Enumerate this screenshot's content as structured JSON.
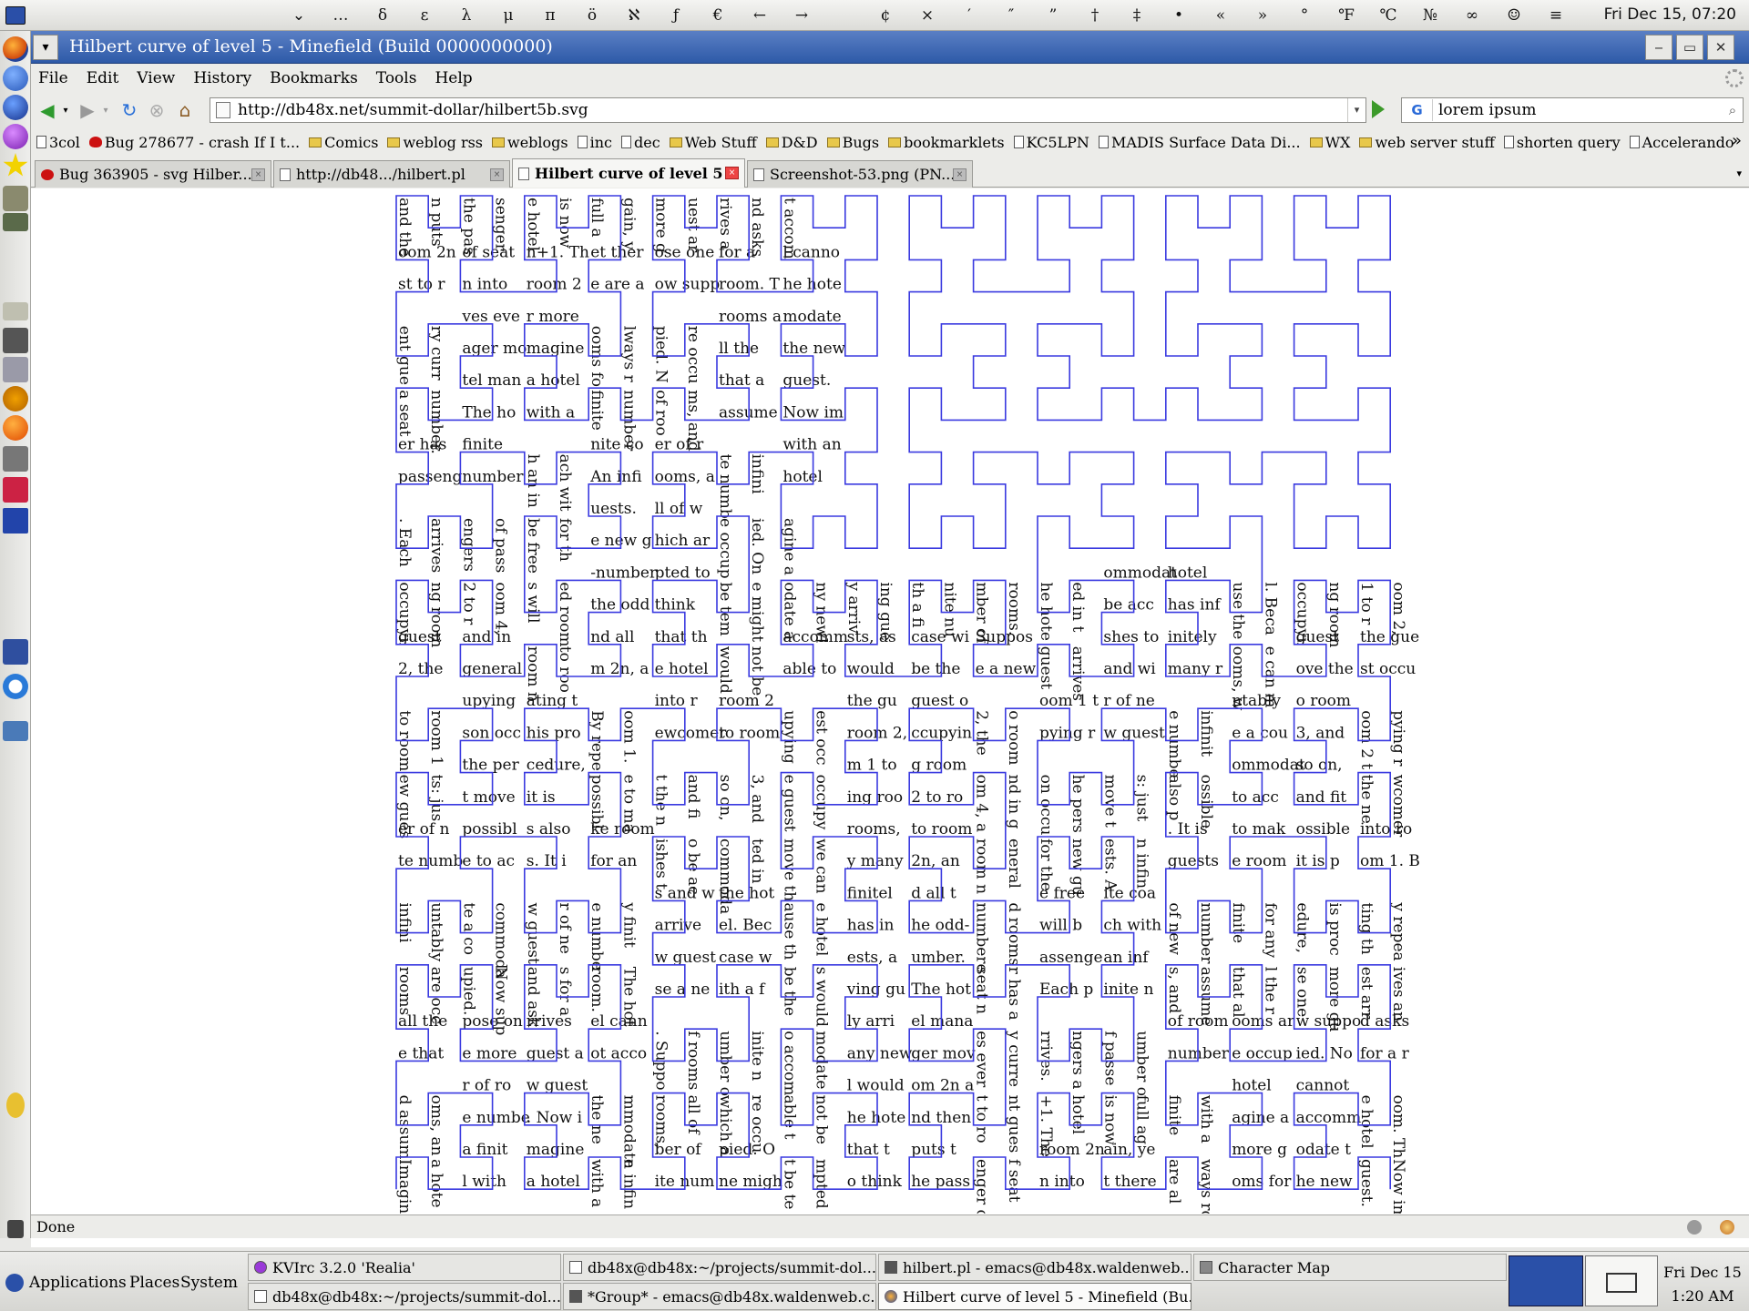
{
  "top_panel": {
    "charmap_glyphs": [
      "⌄",
      "…",
      "δ",
      "ε",
      "λ",
      "μ",
      "π",
      "ö",
      "ℵ",
      "ƒ",
      "€",
      "←",
      "→",
      " ",
      "¢",
      "×",
      "′",
      "″",
      "”",
      "†",
      "‡",
      "•",
      "«",
      "»",
      "°",
      "℉",
      "℃",
      "№",
      "∞",
      "☺",
      "≡"
    ],
    "clock": "Fri Dec 15, 07:20"
  },
  "window": {
    "title": "Hilbert curve of level 5 - Minefield (Build 0000000000)",
    "minimize": "‒",
    "maximize": "▭",
    "close": "✕"
  },
  "menu": [
    "File",
    "Edit",
    "View",
    "History",
    "Bookmarks",
    "Tools",
    "Help"
  ],
  "nav": {
    "url": "http://db48x.net/summit-dollar/hilbert5b.svg",
    "search_engine": "G",
    "search_value": "lorem ipsum"
  },
  "bookmarks": [
    {
      "label": "3col",
      "icon": "page"
    },
    {
      "label": "Bug 278677 - crash If I t...",
      "icon": "bug"
    },
    {
      "label": "Comics",
      "icon": "folder"
    },
    {
      "label": "weblog rss",
      "icon": "folder"
    },
    {
      "label": "weblogs",
      "icon": "folder"
    },
    {
      "label": "inc",
      "icon": "page"
    },
    {
      "label": "dec",
      "icon": "page"
    },
    {
      "label": "Web Stuff",
      "icon": "folder"
    },
    {
      "label": "D&D",
      "icon": "folder"
    },
    {
      "label": "Bugs",
      "icon": "folder"
    },
    {
      "label": "bookmarklets",
      "icon": "folder"
    },
    {
      "label": "KC5LPN",
      "icon": "page"
    },
    {
      "label": "MADIS Surface Data Di...",
      "icon": "page"
    },
    {
      "label": "WX",
      "icon": "folder"
    },
    {
      "label": "web server stuff",
      "icon": "folder"
    },
    {
      "label": "shorten query",
      "icon": "page"
    },
    {
      "label": "Accelerando",
      "icon": "page"
    }
  ],
  "tabs": [
    {
      "label": "Bug 363905 - svg Hilber...",
      "icon": "bug",
      "active": false
    },
    {
      "label": "http://db48.../hilbert.pl",
      "icon": "page",
      "active": false
    },
    {
      "label": "Hilbert curve of level 5",
      "icon": "page",
      "active": true
    },
    {
      "label": "Screenshot-53.png (PN...",
      "icon": "page",
      "active": false
    }
  ],
  "curve": {
    "color": "#3a3ae0",
    "text_sample": "Imagine a hotel with a finite number of rooms, and assume that all the rooms are occupied. Now suppose one more guest arrives and asks for a room. The hotel cannot accommodate the new guest. Now imagine a hotel with an infinite number of rooms, all of which are occupied. One might be tempted to think that the hotel would not be able to accommodate any newly arriving guests, as would be the case with a finite number of rooms. Suppose a new guest arrives and wishes to be accommodated in the hotel. Because the hotel has infinitely many rooms, we can move the guest occupying room 1 to room 2, the guest occupying room 2 to room 3, and so on, and fit the newcomer into room 1. By repeating this procedure, it is possible to make room for any finite number of new guests. It is also possible to accommodate a countably infinite number of new guests: just move the person occupying room 1 to room 2, the guest occupying room 2 to room 4, and in general room n to room 2n, and all the odd-numbered rooms will be free for the new guests. An infinite coach with an infinite number of passengers arrives. Each passenger has a seat number. The hotel manager moves every current guest to room 2n and then puts the passenger of seat n into room 2n+1. The hotel is now full again, yet there are always rooms for more guests."
  },
  "status": {
    "text": "Done"
  },
  "bottom_panel": {
    "menus": [
      "Applications",
      "Places",
      "System"
    ],
    "tasks_row1": [
      {
        "label": "KVIrc 3.2.0 'Realia'",
        "active": false
      },
      {
        "label": "db48x@db48x:~/projects/summit-dol...",
        "active": false
      },
      {
        "label": "hilbert.pl - emacs@db48x.waldenweb...",
        "active": false
      },
      {
        "label": "Character Map",
        "active": false
      }
    ],
    "tasks_row2": [
      {
        "label": "db48x@db48x:~/projects/summit-dol...",
        "active": false
      },
      {
        "label": "*Group* - emacs@db48x.waldenweb.c...",
        "active": false
      },
      {
        "label": "Hilbert curve of level 5 - Minefield (Bu...",
        "active": true
      }
    ],
    "clock_day": "Fri Dec 15",
    "clock_time": "1:20 AM"
  }
}
